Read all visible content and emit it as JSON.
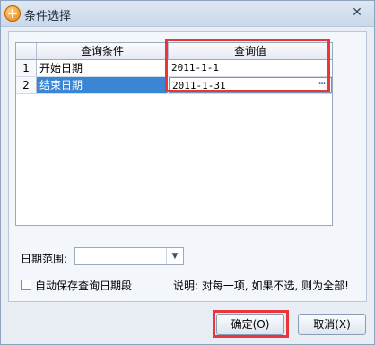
{
  "window": {
    "title": "条件选择",
    "close_icon": "close-icon"
  },
  "grid": {
    "headers": [
      "",
      "查询条件",
      "查询值"
    ],
    "rows": [
      {
        "num": "1",
        "condition": "开始日期",
        "value": "2011-1-1",
        "selected": false
      },
      {
        "num": "2",
        "condition": "结束日期",
        "value": "2011-1-31",
        "selected": true
      }
    ],
    "ellipsis_label": "⋯"
  },
  "range": {
    "label": "日期范围:",
    "selected_value": ""
  },
  "autosave": {
    "label": "自动保存查询日期段",
    "checked": false
  },
  "hint": "说明: 对每一项, 如果不选, 则为全部!",
  "buttons": {
    "ok": "确定(O)",
    "cancel": "取消(X)"
  },
  "colors": {
    "highlight": "#e8363b",
    "selection": "#3a85d4"
  }
}
